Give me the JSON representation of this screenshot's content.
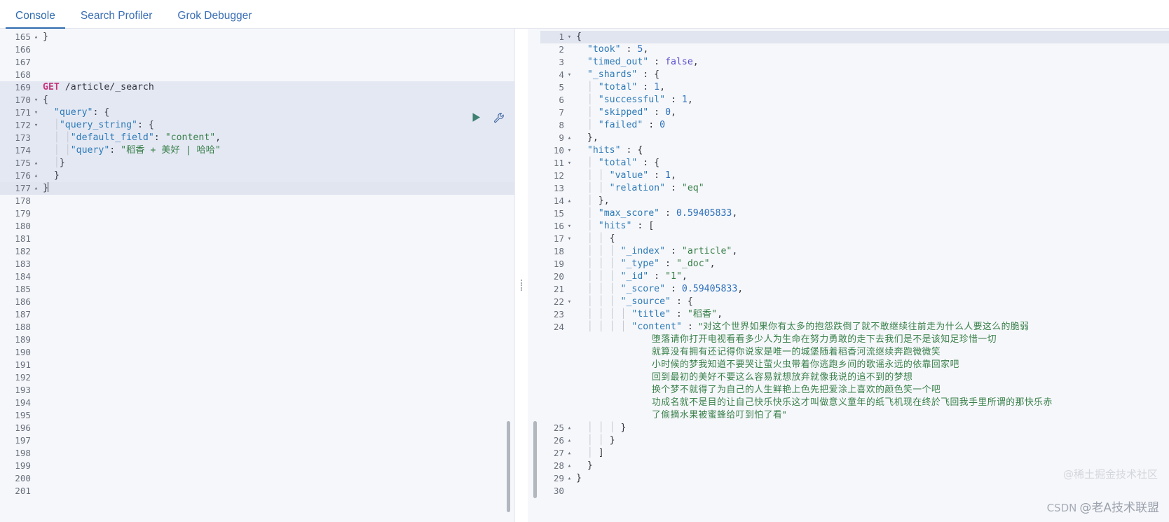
{
  "tabs": [
    {
      "id": "console",
      "label": "Console",
      "active": true
    },
    {
      "id": "search-profiler",
      "label": "Search Profiler",
      "active": false
    },
    {
      "id": "grok-debugger",
      "label": "Grok Debugger",
      "active": false
    }
  ],
  "request_editor": {
    "name": "console-request-editor",
    "first_line_number": 165,
    "last_line_number": 201,
    "active_line": 177,
    "method": "GET",
    "path": "/article/_search",
    "play_icon": "play-triangle-icon",
    "wrench_icon": "wrench-icon",
    "lines": [
      {
        "n": 165,
        "fold": "▴",
        "segs": [
          {
            "t": "}",
            "c": "k-punc"
          }
        ]
      },
      {
        "n": 166,
        "fold": "",
        "segs": []
      },
      {
        "n": 167,
        "fold": "",
        "segs": []
      },
      {
        "n": 168,
        "fold": "",
        "segs": []
      },
      {
        "n": 169,
        "fold": "",
        "hl": true,
        "segs": [
          {
            "t": "GET",
            "c": "k-method"
          },
          {
            "t": " /article/_search",
            "c": "k-url"
          }
        ]
      },
      {
        "n": 170,
        "fold": "▾",
        "hl": true,
        "segs": [
          {
            "t": "{",
            "c": "k-punc"
          }
        ]
      },
      {
        "n": 171,
        "fold": "▾",
        "hl": true,
        "segs": [
          {
            "t": "  ",
            "c": "k-plain"
          },
          {
            "t": "\"query\"",
            "c": "k-key"
          },
          {
            "t": ": {",
            "c": "k-punc"
          }
        ]
      },
      {
        "n": 172,
        "fold": "▾",
        "hl": true,
        "segs": [
          {
            "t": "  │",
            "c": "indent-guide"
          },
          {
            "t": "\"query_string\"",
            "c": "k-key"
          },
          {
            "t": ": {",
            "c": "k-punc"
          }
        ]
      },
      {
        "n": 173,
        "fold": "",
        "hl": true,
        "segs": [
          {
            "t": "  │ │",
            "c": "indent-guide"
          },
          {
            "t": "\"default_field\"",
            "c": "k-key"
          },
          {
            "t": ": ",
            "c": "k-punc"
          },
          {
            "t": "\"content\"",
            "c": "k-str"
          },
          {
            "t": ",",
            "c": "k-punc"
          }
        ]
      },
      {
        "n": 174,
        "fold": "",
        "hl": true,
        "segs": [
          {
            "t": "  │ │",
            "c": "indent-guide"
          },
          {
            "t": "\"query\"",
            "c": "k-key"
          },
          {
            "t": ": ",
            "c": "k-punc"
          },
          {
            "t": "\"稻香 + 美好 | 哈哈\"",
            "c": "k-str"
          }
        ]
      },
      {
        "n": 175,
        "fold": "▴",
        "hl": true,
        "segs": [
          {
            "t": "  │",
            "c": "indent-guide"
          },
          {
            "t": "}",
            "c": "k-punc"
          }
        ]
      },
      {
        "n": 176,
        "fold": "▴",
        "hl": true,
        "segs": [
          {
            "t": "  }",
            "c": "k-punc"
          }
        ]
      },
      {
        "n": 177,
        "fold": "▴",
        "active": true,
        "segs": [
          {
            "t": "}",
            "c": "k-punc"
          },
          {
            "caret": true
          }
        ]
      },
      {
        "n": 178,
        "fold": "",
        "segs": []
      },
      {
        "n": 179,
        "fold": "",
        "segs": []
      },
      {
        "n": 180,
        "fold": "",
        "segs": []
      },
      {
        "n": 181,
        "fold": "",
        "segs": []
      },
      {
        "n": 182,
        "fold": "",
        "segs": []
      },
      {
        "n": 183,
        "fold": "",
        "segs": []
      },
      {
        "n": 184,
        "fold": "",
        "segs": []
      },
      {
        "n": 185,
        "fold": "",
        "segs": []
      },
      {
        "n": 186,
        "fold": "",
        "segs": []
      },
      {
        "n": 187,
        "fold": "",
        "segs": []
      },
      {
        "n": 188,
        "fold": "",
        "segs": []
      },
      {
        "n": 189,
        "fold": "",
        "segs": []
      },
      {
        "n": 190,
        "fold": "",
        "segs": []
      },
      {
        "n": 191,
        "fold": "",
        "segs": []
      },
      {
        "n": 192,
        "fold": "",
        "segs": []
      },
      {
        "n": 193,
        "fold": "",
        "segs": []
      },
      {
        "n": 194,
        "fold": "",
        "segs": []
      },
      {
        "n": 195,
        "fold": "",
        "segs": []
      },
      {
        "n": 196,
        "fold": "",
        "segs": []
      },
      {
        "n": 197,
        "fold": "",
        "segs": []
      },
      {
        "n": 198,
        "fold": "",
        "segs": []
      },
      {
        "n": 199,
        "fold": "",
        "segs": []
      },
      {
        "n": 200,
        "fold": "",
        "segs": []
      },
      {
        "n": 201,
        "fold": "",
        "segs": []
      }
    ]
  },
  "response_viewer": {
    "name": "console-response-viewer",
    "first_line_number": 1,
    "last_line_number": 30,
    "active_line": 1,
    "lines": [
      {
        "n": 1,
        "fold": "▾",
        "active": true,
        "segs": [
          {
            "t": "{",
            "c": "k-punc"
          }
        ]
      },
      {
        "n": 2,
        "fold": "",
        "segs": [
          {
            "t": "  ",
            "c": "k-plain"
          },
          {
            "t": "\"took\"",
            "c": "k-key"
          },
          {
            "t": " : ",
            "c": "k-punc"
          },
          {
            "t": "5",
            "c": "k-num"
          },
          {
            "t": ",",
            "c": "k-punc"
          }
        ]
      },
      {
        "n": 3,
        "fold": "",
        "segs": [
          {
            "t": "  ",
            "c": "k-plain"
          },
          {
            "t": "\"timed_out\"",
            "c": "k-key"
          },
          {
            "t": " : ",
            "c": "k-punc"
          },
          {
            "t": "false",
            "c": "k-bool"
          },
          {
            "t": ",",
            "c": "k-punc"
          }
        ]
      },
      {
        "n": 4,
        "fold": "▾",
        "segs": [
          {
            "t": "  ",
            "c": "k-plain"
          },
          {
            "t": "\"_shards\"",
            "c": "k-key"
          },
          {
            "t": " : {",
            "c": "k-punc"
          }
        ]
      },
      {
        "n": 5,
        "fold": "",
        "segs": [
          {
            "t": "  │ ",
            "c": "indent-guide"
          },
          {
            "t": "\"total\"",
            "c": "k-key"
          },
          {
            "t": " : ",
            "c": "k-punc"
          },
          {
            "t": "1",
            "c": "k-num"
          },
          {
            "t": ",",
            "c": "k-punc"
          }
        ]
      },
      {
        "n": 6,
        "fold": "",
        "segs": [
          {
            "t": "  │ ",
            "c": "indent-guide"
          },
          {
            "t": "\"successful\"",
            "c": "k-key"
          },
          {
            "t": " : ",
            "c": "k-punc"
          },
          {
            "t": "1",
            "c": "k-num"
          },
          {
            "t": ",",
            "c": "k-punc"
          }
        ]
      },
      {
        "n": 7,
        "fold": "",
        "segs": [
          {
            "t": "  │ ",
            "c": "indent-guide"
          },
          {
            "t": "\"skipped\"",
            "c": "k-key"
          },
          {
            "t": " : ",
            "c": "k-punc"
          },
          {
            "t": "0",
            "c": "k-num"
          },
          {
            "t": ",",
            "c": "k-punc"
          }
        ]
      },
      {
        "n": 8,
        "fold": "",
        "segs": [
          {
            "t": "  │ ",
            "c": "indent-guide"
          },
          {
            "t": "\"failed\"",
            "c": "k-key"
          },
          {
            "t": " : ",
            "c": "k-punc"
          },
          {
            "t": "0",
            "c": "k-num"
          }
        ]
      },
      {
        "n": 9,
        "fold": "▴",
        "segs": [
          {
            "t": "  },",
            "c": "k-punc"
          }
        ]
      },
      {
        "n": 10,
        "fold": "▾",
        "segs": [
          {
            "t": "  ",
            "c": "k-plain"
          },
          {
            "t": "\"hits\"",
            "c": "k-key"
          },
          {
            "t": " : {",
            "c": "k-punc"
          }
        ]
      },
      {
        "n": 11,
        "fold": "▾",
        "segs": [
          {
            "t": "  │ ",
            "c": "indent-guide"
          },
          {
            "t": "\"total\"",
            "c": "k-key"
          },
          {
            "t": " : {",
            "c": "k-punc"
          }
        ]
      },
      {
        "n": 12,
        "fold": "",
        "segs": [
          {
            "t": "  │ │ ",
            "c": "indent-guide"
          },
          {
            "t": "\"value\"",
            "c": "k-key"
          },
          {
            "t": " : ",
            "c": "k-punc"
          },
          {
            "t": "1",
            "c": "k-num"
          },
          {
            "t": ",",
            "c": "k-punc"
          }
        ]
      },
      {
        "n": 13,
        "fold": "",
        "segs": [
          {
            "t": "  │ │ ",
            "c": "indent-guide"
          },
          {
            "t": "\"relation\"",
            "c": "k-key"
          },
          {
            "t": " : ",
            "c": "k-punc"
          },
          {
            "t": "\"eq\"",
            "c": "k-str"
          }
        ]
      },
      {
        "n": 14,
        "fold": "▴",
        "segs": [
          {
            "t": "  │ ",
            "c": "indent-guide"
          },
          {
            "t": "},",
            "c": "k-punc"
          }
        ]
      },
      {
        "n": 15,
        "fold": "",
        "segs": [
          {
            "t": "  │ ",
            "c": "indent-guide"
          },
          {
            "t": "\"max_score\"",
            "c": "k-key"
          },
          {
            "t": " : ",
            "c": "k-punc"
          },
          {
            "t": "0.59405833",
            "c": "k-num"
          },
          {
            "t": ",",
            "c": "k-punc"
          }
        ]
      },
      {
        "n": 16,
        "fold": "▾",
        "segs": [
          {
            "t": "  │ ",
            "c": "indent-guide"
          },
          {
            "t": "\"hits\"",
            "c": "k-key"
          },
          {
            "t": " : [",
            "c": "k-punc"
          }
        ]
      },
      {
        "n": 17,
        "fold": "▾",
        "segs": [
          {
            "t": "  │ │ ",
            "c": "indent-guide"
          },
          {
            "t": "{",
            "c": "k-punc"
          }
        ]
      },
      {
        "n": 18,
        "fold": "",
        "segs": [
          {
            "t": "  │ │ │ ",
            "c": "indent-guide"
          },
          {
            "t": "\"_index\"",
            "c": "k-key"
          },
          {
            "t": " : ",
            "c": "k-punc"
          },
          {
            "t": "\"article\"",
            "c": "k-str"
          },
          {
            "t": ",",
            "c": "k-punc"
          }
        ]
      },
      {
        "n": 19,
        "fold": "",
        "segs": [
          {
            "t": "  │ │ │ ",
            "c": "indent-guide"
          },
          {
            "t": "\"_type\"",
            "c": "k-key"
          },
          {
            "t": " : ",
            "c": "k-punc"
          },
          {
            "t": "\"_doc\"",
            "c": "k-str"
          },
          {
            "t": ",",
            "c": "k-punc"
          }
        ]
      },
      {
        "n": 20,
        "fold": "",
        "segs": [
          {
            "t": "  │ │ │ ",
            "c": "indent-guide"
          },
          {
            "t": "\"_id\"",
            "c": "k-key"
          },
          {
            "t": " : ",
            "c": "k-punc"
          },
          {
            "t": "\"1\"",
            "c": "k-str"
          },
          {
            "t": ",",
            "c": "k-punc"
          }
        ]
      },
      {
        "n": 21,
        "fold": "",
        "segs": [
          {
            "t": "  │ │ │ ",
            "c": "indent-guide"
          },
          {
            "t": "\"_score\"",
            "c": "k-key"
          },
          {
            "t": " : ",
            "c": "k-punc"
          },
          {
            "t": "0.59405833",
            "c": "k-num"
          },
          {
            "t": ",",
            "c": "k-punc"
          }
        ]
      },
      {
        "n": 22,
        "fold": "▾",
        "segs": [
          {
            "t": "  │ │ │ ",
            "c": "indent-guide"
          },
          {
            "t": "\"_source\"",
            "c": "k-key"
          },
          {
            "t": " : {",
            "c": "k-punc"
          }
        ]
      },
      {
        "n": 23,
        "fold": "",
        "segs": [
          {
            "t": "  │ │ │ │ ",
            "c": "indent-guide"
          },
          {
            "t": "\"title\"",
            "c": "k-key"
          },
          {
            "t": " : ",
            "c": "k-punc"
          },
          {
            "t": "\"稻香\"",
            "c": "k-str"
          },
          {
            "t": ",",
            "c": "k-punc"
          }
        ]
      },
      {
        "n": 24,
        "fold": "",
        "segs": [
          {
            "t": "  │ │ │ │ ",
            "c": "indent-guide"
          },
          {
            "t": "\"content\"",
            "c": "k-key"
          },
          {
            "t": " : ",
            "c": "k-punc"
          },
          {
            "t": "\"对这个世界如果你有太多的抱怨跌倒了就不敢继续往前走为什么人要这么的脆弱",
            "c": "k-str cjk"
          }
        ]
      },
      {
        "n": 25,
        "fold": "▴",
        "segs": [
          {
            "t": "  │ │ │ ",
            "c": "indent-guide"
          },
          {
            "t": "}",
            "c": "k-punc"
          }
        ]
      },
      {
        "n": 26,
        "fold": "▴",
        "segs": [
          {
            "t": "  │ │ ",
            "c": "indent-guide"
          },
          {
            "t": "}",
            "c": "k-punc"
          }
        ]
      },
      {
        "n": 27,
        "fold": "▴",
        "segs": [
          {
            "t": "  │ ",
            "c": "indent-guide"
          },
          {
            "t": "]",
            "c": "k-punc"
          }
        ]
      },
      {
        "n": 28,
        "fold": "▴",
        "segs": [
          {
            "t": "  }",
            "c": "k-punc"
          }
        ]
      },
      {
        "n": 29,
        "fold": "▴",
        "segs": [
          {
            "t": "}",
            "c": "k-punc"
          }
        ]
      },
      {
        "n": 30,
        "fold": "",
        "segs": []
      }
    ],
    "content_wrapped_lines": [
      "堕落请你打开电视看看多少人为生命在努力勇敢的走下去我们是不是该知足珍惜一切",
      "就算没有拥有还记得你说家是唯一的城堡随着稻香河流继续奔跑微微笑",
      "小时候的梦我知道不要哭让萤火虫带着你逃跑乡间的歌谣永远的依靠回家吧",
      "回到最初的美好不要这么容易就想放弃就像我说的追不到的梦想",
      "换个梦不就得了为自己的人生鲜艳上色先把爱涂上喜欢的颜色笑一个吧",
      "功成名就不是目的让自己快乐快乐这才叫做意义童年的纸飞机现在终於飞回我手里所谓的那快乐赤",
      "了偷摘水果被蜜蜂给叮到怕了看\""
    ]
  },
  "watermarks": {
    "top": "@稀土掘金技术社区",
    "csdn": "CSDN",
    "bottom": "@老A技术联盟"
  },
  "colors": {
    "accent": "#2f6bb0",
    "method": "#c6357c",
    "string": "#377f49",
    "key": "#2c7ab8",
    "number": "#2c6fbb",
    "boolean": "#5b4fd1",
    "editor_bg": "#f6f7fa",
    "highlight_bg": "#e4e8f3",
    "play": "#3e8072"
  }
}
